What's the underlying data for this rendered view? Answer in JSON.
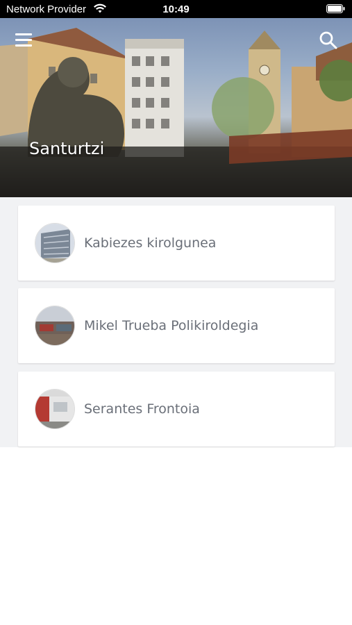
{
  "status_bar": {
    "carrier": "Network Provider",
    "time": "10:49"
  },
  "header": {
    "title": "Santurtzi",
    "menu_icon": "hamburger-menu-icon",
    "search_icon": "search-icon"
  },
  "facilities": [
    {
      "name": "Kabiezes kirolgunea"
    },
    {
      "name": "Mikel Trueba Polikiroldegia"
    },
    {
      "name": "Serantes Frontoia"
    }
  ]
}
